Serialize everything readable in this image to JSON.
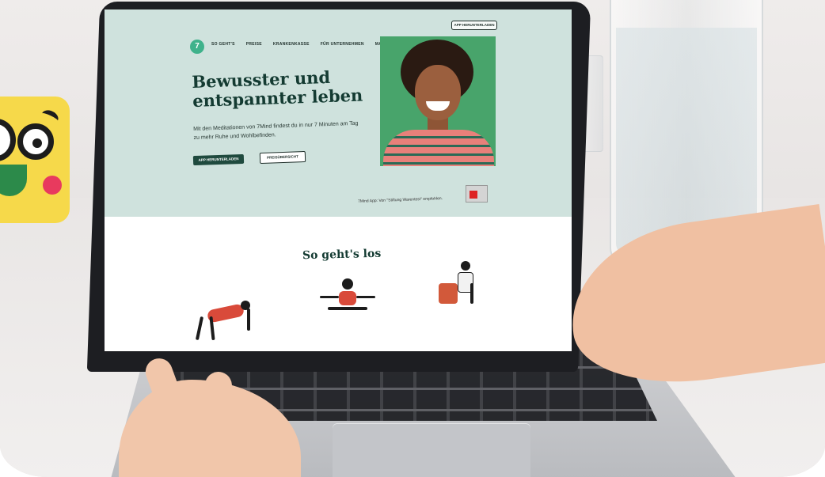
{
  "site": {
    "nav": {
      "logo": "7",
      "items": [
        "SO GEHT'S",
        "PREISE",
        "KRANKENKASSE",
        "FÜR UNTERNEHMEN",
        "MAGAZIN"
      ],
      "download_button": "APP HERUNTERLADEN"
    },
    "hero": {
      "title": "Bewusster und entspannter leben",
      "text": "Mit den Meditationen von 7Mind findest du in nur 7 Minuten am Tag zu mehr Ruhe und Wohlbefinden.",
      "primary_button": "APP HERUNTERLADEN",
      "secondary_button": "PREISÜBERSICHT"
    },
    "trust_text": "7Mind App: Von \"Stiftung Warentest\" empfohlen.",
    "section_title": "So geht's los"
  },
  "colors": {
    "hero_bg": "#cfe2dd",
    "accent_green": "#1f4a3e",
    "logo_green": "#3fb28b",
    "badge_yellow": "#f6d94a"
  }
}
